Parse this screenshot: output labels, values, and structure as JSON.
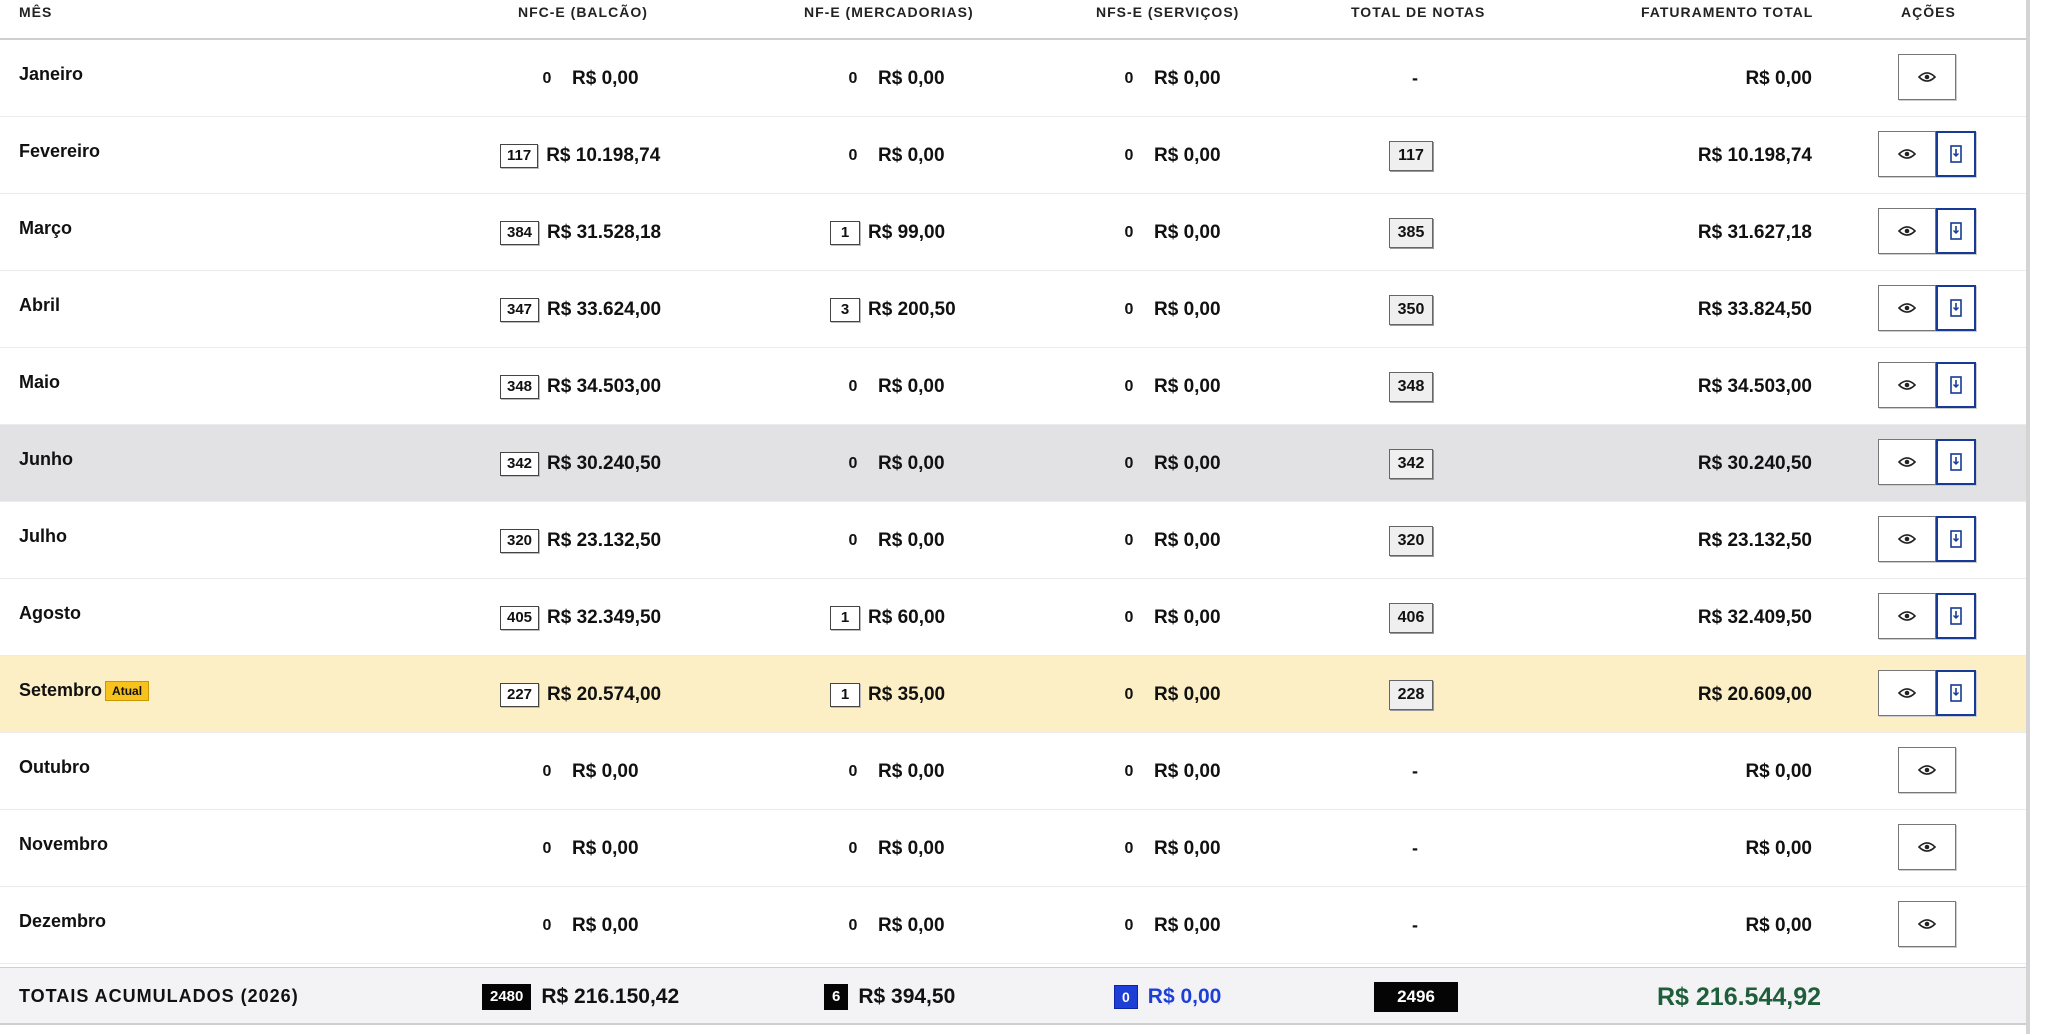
{
  "header": {
    "mes": "MÊS",
    "nfce": "NFC-E (BALCÃO)",
    "nfe": "NF-E (MERCADORIAS)",
    "nfse": "NFS-E (SERVIÇOS)",
    "total": "TOTAL DE NOTAS",
    "fat": "FATURAMENTO TOTAL",
    "acoes": "AÇÕES"
  },
  "current_badge": "Atual",
  "rows": [
    {
      "month": "Janeiro",
      "nfce_count": "0",
      "nfce_amt": "R$ 0,00",
      "nfe_count": "0",
      "nfe_amt": "R$ 0,00",
      "nfse_count": "0",
      "nfse_amt": "R$ 0,00",
      "total": "-",
      "fat": "R$ 0,00"
    },
    {
      "month": "Fevereiro",
      "nfce_count": "117",
      "nfce_amt": "R$ 10.198,74",
      "nfe_count": "0",
      "nfe_amt": "R$ 0,00",
      "nfse_count": "0",
      "nfse_amt": "R$ 0,00",
      "total": "117",
      "fat": "R$ 10.198,74"
    },
    {
      "month": "Março",
      "nfce_count": "384",
      "nfce_amt": "R$ 31.528,18",
      "nfe_count": "1",
      "nfe_amt": "R$ 99,00",
      "nfse_count": "0",
      "nfse_amt": "R$ 0,00",
      "total": "385",
      "fat": "R$ 31.627,18"
    },
    {
      "month": "Abril",
      "nfce_count": "347",
      "nfce_amt": "R$ 33.624,00",
      "nfe_count": "3",
      "nfe_amt": "R$ 200,50",
      "nfse_count": "0",
      "nfse_amt": "R$ 0,00",
      "total": "350",
      "fat": "R$ 33.824,50"
    },
    {
      "month": "Maio",
      "nfce_count": "348",
      "nfce_amt": "R$ 34.503,00",
      "nfe_count": "0",
      "nfe_amt": "R$ 0,00",
      "nfse_count": "0",
      "nfse_amt": "R$ 0,00",
      "total": "348",
      "fat": "R$ 34.503,00"
    },
    {
      "month": "Junho",
      "nfce_count": "342",
      "nfce_amt": "R$ 30.240,50",
      "nfe_count": "0",
      "nfe_amt": "R$ 0,00",
      "nfse_count": "0",
      "nfse_amt": "R$ 0,00",
      "total": "342",
      "fat": "R$ 30.240,50"
    },
    {
      "month": "Julho",
      "nfce_count": "320",
      "nfce_amt": "R$ 23.132,50",
      "nfe_count": "0",
      "nfe_amt": "R$ 0,00",
      "nfse_count": "0",
      "nfse_amt": "R$ 0,00",
      "total": "320",
      "fat": "R$ 23.132,50"
    },
    {
      "month": "Agosto",
      "nfce_count": "405",
      "nfce_amt": "R$ 32.349,50",
      "nfe_count": "1",
      "nfe_amt": "R$ 60,00",
      "nfse_count": "0",
      "nfse_amt": "R$ 0,00",
      "total": "406",
      "fat": "R$ 32.409,50"
    },
    {
      "month": "Setembro",
      "nfce_count": "227",
      "nfce_amt": "R$ 20.574,00",
      "nfe_count": "1",
      "nfe_amt": "R$ 35,00",
      "nfse_count": "0",
      "nfse_amt": "R$ 0,00",
      "total": "228",
      "fat": "R$ 20.609,00"
    },
    {
      "month": "Outubro",
      "nfce_count": "0",
      "nfce_amt": "R$ 0,00",
      "nfe_count": "0",
      "nfe_amt": "R$ 0,00",
      "nfse_count": "0",
      "nfse_amt": "R$ 0,00",
      "total": "-",
      "fat": "R$ 0,00"
    },
    {
      "month": "Novembro",
      "nfce_count": "0",
      "nfce_amt": "R$ 0,00",
      "nfe_count": "0",
      "nfe_amt": "R$ 0,00",
      "nfse_count": "0",
      "nfse_amt": "R$ 0,00",
      "total": "-",
      "fat": "R$ 0,00"
    },
    {
      "month": "Dezembro",
      "nfce_count": "0",
      "nfce_amt": "R$ 0,00",
      "nfe_count": "0",
      "nfe_amt": "R$ 0,00",
      "nfse_count": "0",
      "nfse_amt": "R$ 0,00",
      "total": "-",
      "fat": "R$ 0,00"
    }
  ],
  "footer": {
    "label": "TOTAIS ACUMULADOS (2026)",
    "nfce_count": "2480",
    "nfce_amt": "R$ 216.150,42",
    "nfe_count": "6",
    "nfe_amt": "R$ 394,50",
    "nfse_count": "0",
    "nfse_amt": "R$ 0,00",
    "total": "2496",
    "fat": "R$ 216.544,92"
  },
  "icons": {
    "view": "eye-icon",
    "pdf": "pdf-document-icon"
  },
  "colors": {
    "current_row": "#fcefc5",
    "hover_row": "#e2e2e4",
    "badge_atual": "#f7c21b",
    "pdf_border": "#163b96",
    "nfse_total": "#1d3fd6",
    "fat_total": "#1e5e3a"
  }
}
